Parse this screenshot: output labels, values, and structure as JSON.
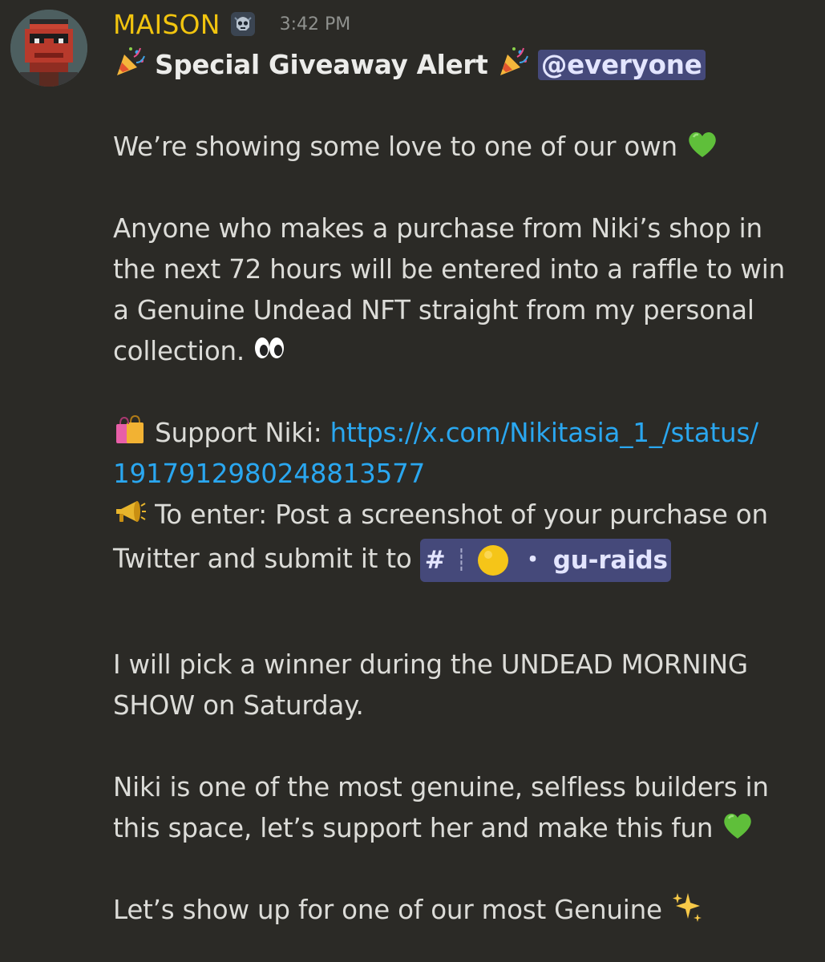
{
  "message": {
    "username": "MAISON",
    "timestamp": "3:42 PM",
    "title": "Special Giveaway Alert",
    "mention": "@everyone",
    "line_love": "We’re showing some love to one of our own",
    "para1": [
      "Anyone who makes a purchase from Niki’s shop in",
      "the next 72 hours will be entered into a raffle to win",
      "a Genuine Undead NFT straight from my  personal",
      "collection."
    ],
    "support_label": "Support Niki:",
    "support_link_1": "https://x.com/Nikitasia_1_/status/",
    "support_link_2": "1917912980248813577",
    "enter_label": "To enter: Post a screenshot of your purchase on",
    "enter_line2": "Twitter and submit it to",
    "channel": {
      "hash": "#",
      "separator": "┊",
      "bullet": "・",
      "name": "gu-raids"
    },
    "winner": [
      "I will pick a winner during the UNDEAD MORNING",
      "SHOW on Saturday."
    ],
    "niki": [
      "Niki is one of the most genuine, selfless builders in",
      "this space, let’s support her and make this fun"
    ],
    "closing": "Let’s show up for one of our most Genuine"
  },
  "colors": {
    "background": "#2b2a26",
    "username": "#f1c40f",
    "link": "#2aa7f0",
    "mention_bg": "#45497a"
  },
  "icons": {
    "party": "party-popper-icon",
    "green_heart": "green-heart-icon",
    "eyes": "eyes-icon",
    "shopping_bags": "shopping-bags-icon",
    "megaphone": "megaphone-icon",
    "yellow_circle": "yellow-circle-icon",
    "sparkles": "sparkles-icon",
    "server_tag": "skull-server-tag-icon"
  }
}
